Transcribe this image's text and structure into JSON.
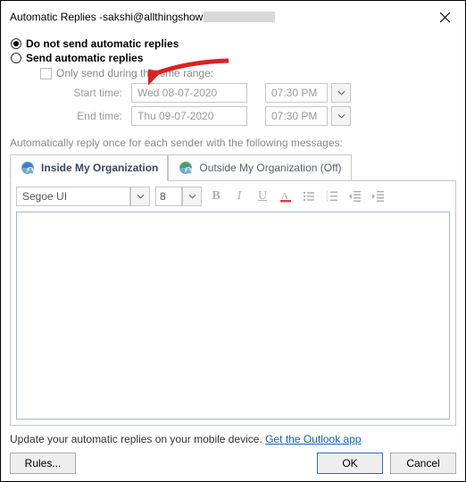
{
  "window": {
    "title_prefix": "Automatic Replies - ",
    "email_visible": "sakshi@allthingshow"
  },
  "radios": {
    "no_send": "Do not send automatic replies",
    "send": "Send automatic replies",
    "selected": "no_send"
  },
  "time_range": {
    "checkbox_label": "Only send during this time range:",
    "start_label": "Start time:",
    "end_label": "End time:",
    "start_date": "Wed 08-07-2020",
    "start_time": "07:30 PM",
    "end_date": "Thu 09-07-2020",
    "end_time": "07:30 PM"
  },
  "section_note": "Automatically reply once for each sender with the following messages:",
  "tabs": {
    "inside": "Inside My Organization",
    "outside": "Outside My Organization (Off)"
  },
  "toolbar": {
    "font_name": "Segoe UI",
    "font_size": "8"
  },
  "footer": {
    "text": "Update your automatic replies on your mobile device. ",
    "link": "Get the Outlook app"
  },
  "buttons": {
    "rules": "Rules...",
    "ok": "OK",
    "cancel": "Cancel"
  }
}
